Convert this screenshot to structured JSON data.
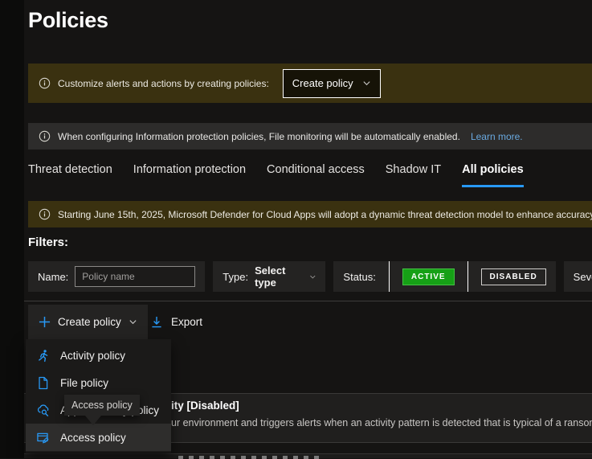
{
  "page": {
    "title": "Policies"
  },
  "banners": {
    "create": {
      "text": "Customize alerts and actions by creating policies:",
      "button_label": "Create policy"
    },
    "info": {
      "text": "When configuring Information protection policies, File monitoring will be automatically enabled.",
      "link": "Learn more."
    },
    "notice": {
      "text": "Starting June 15th, 2025, Microsoft Defender for Cloud Apps will adopt a dynamic threat detection model to enhance accuracy"
    }
  },
  "tabs": {
    "items": [
      {
        "label": "Threat detection"
      },
      {
        "label": "Information protection"
      },
      {
        "label": "Conditional access"
      },
      {
        "label": "Shadow IT"
      },
      {
        "label": "All policies"
      }
    ],
    "active": "All policies",
    "active_underline_color": "#2899f5"
  },
  "filters": {
    "heading": "Filters:",
    "name_label": "Name:",
    "name_placeholder": "Policy name",
    "type_label": "Type:",
    "type_value": "Select type",
    "status_label": "Status:",
    "status_active": "ACTIVE",
    "status_disabled": "DISABLED",
    "severity_label": "Severity:",
    "severity_swatches": [
      "#e8731a",
      "#8a8886"
    ],
    "active_green": "#16a016"
  },
  "toolbar": {
    "create_label": "Create policy",
    "export_label": "Export",
    "accent_blue": "#2899f5"
  },
  "menu": {
    "items": [
      {
        "label": "Activity policy",
        "icon": "activity-policy-icon"
      },
      {
        "label": "File policy",
        "icon": "file-policy-icon"
      },
      {
        "label": "App discovery policy",
        "icon": "app-discovery-policy-icon"
      },
      {
        "label": "Access policy",
        "icon": "access-policy-icon"
      }
    ],
    "highlighted": "Access policy"
  },
  "tooltip": {
    "text": "Access policy"
  },
  "list": {
    "row1_title_visible_fragment": "ity [Disabled]",
    "row1_desc_visible_fragment": "ur environment and triggers alerts when an activity pattern is detected that is typical of a ransomw"
  }
}
